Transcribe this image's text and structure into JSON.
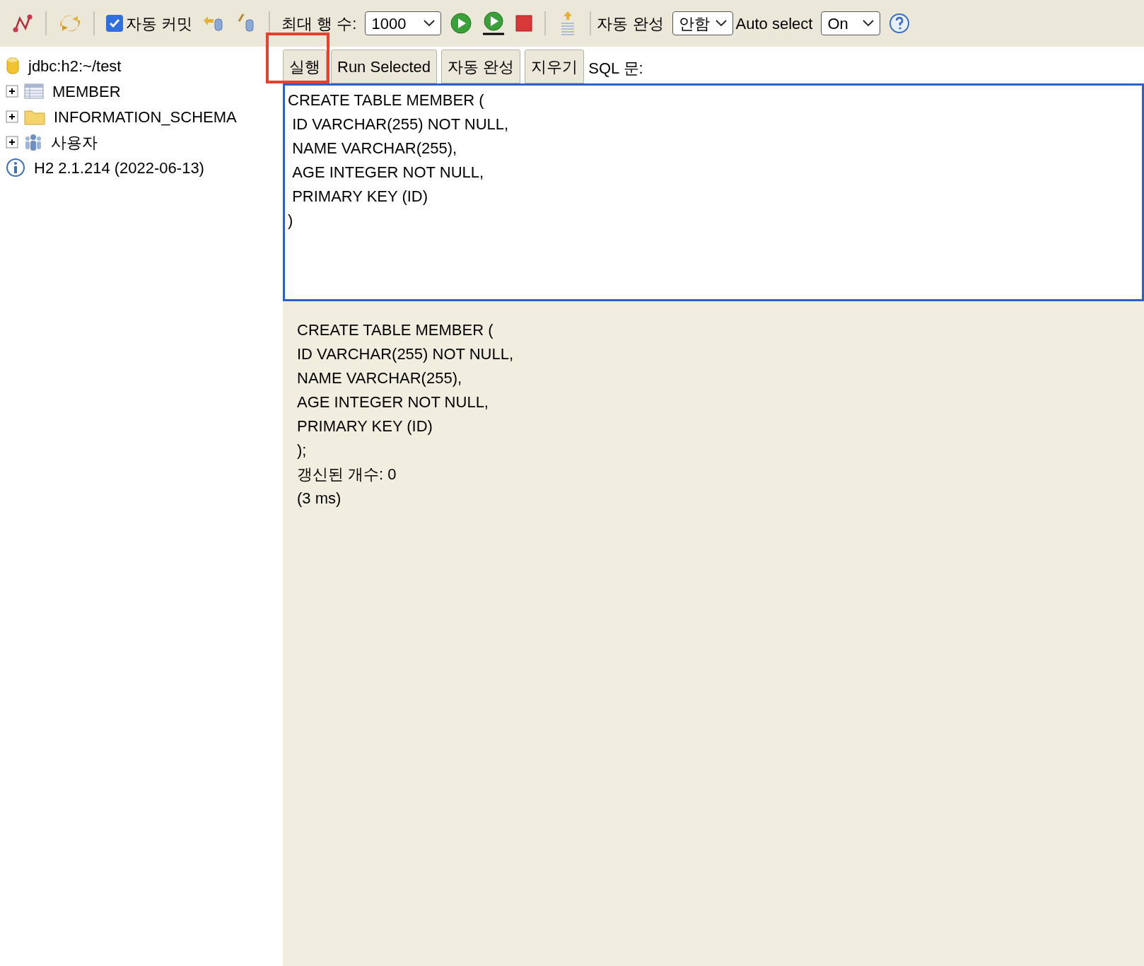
{
  "toolbar": {
    "autocommit": {
      "label": "자동 커밋",
      "checked": true
    },
    "max_rows": {
      "label": "최대 행 수:",
      "value": "1000"
    },
    "autocomplete": {
      "label": "자동 완성",
      "value": "안함"
    },
    "auto_select": {
      "label": "Auto select",
      "value": "On"
    }
  },
  "sidebar": {
    "items": [
      {
        "kind": "connection",
        "label": "jdbc:h2:~/test"
      },
      {
        "kind": "table",
        "label": "MEMBER",
        "expanded": false
      },
      {
        "kind": "folder",
        "label": "INFORMATION_SCHEMA",
        "expanded": false
      },
      {
        "kind": "users",
        "label": "사용자",
        "expanded": false
      },
      {
        "kind": "info",
        "label": "H2 2.1.214 (2022-06-13)"
      }
    ]
  },
  "editor": {
    "buttons": [
      "실행",
      "Run Selected",
      "자동 완성",
      "지우기"
    ],
    "label": "SQL 문:",
    "value": "CREATE TABLE MEMBER (\n ID VARCHAR(255) NOT NULL,\n NAME VARCHAR(255),\n AGE INTEGER NOT NULL,\n PRIMARY KEY (ID)\n)"
  },
  "result": {
    "lines": [
      "CREATE TABLE MEMBER (",
      "ID VARCHAR(255) NOT NULL,",
      "NAME VARCHAR(255),",
      "AGE INTEGER NOT NULL,",
      "PRIMARY KEY (ID)",
      ");",
      "갱신된 개수: 0",
      "(3 ms)"
    ]
  }
}
